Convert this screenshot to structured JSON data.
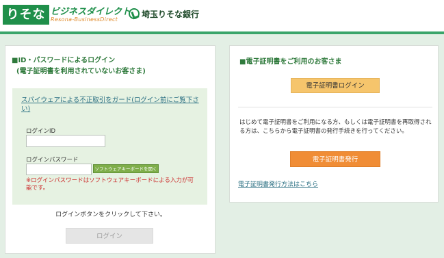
{
  "header": {
    "logo_resona": "りそな",
    "logo_business_direct": "ビジネスダイレクト",
    "logo_business_direct_en": "Resona-BusinessDirect",
    "bank_name": "埼玉りそな銀行"
  },
  "left_panel": {
    "title_line1": "■ID・パスワードによるログイン",
    "title_line2": "(電子証明書を利用されていないお客さま)",
    "spyware_link": "スパイウェアによる不正取引をガード(ログイン前にご覧下さい)",
    "login_id_label": "ログインID",
    "login_id_value": "",
    "login_password_label": "ログインパスワード",
    "login_password_value": "",
    "software_keyboard_button": "ソフトウェアキーボードを開く",
    "warning_text": "※ログインパスワードはソフトウェアキーボードによる入力が可能です。",
    "click_note": "ログインボタンをクリックして下さい。",
    "login_button": "ログイン"
  },
  "right_panel": {
    "title": "■電子証明書をご利用のお客さま",
    "cert_login_button": "電子証明書ログイン",
    "description": "はじめて電子証明書をご利用になる方、もしくは電子証明書を再取得される方は、こちらから電子証明書の発行手続きを行ってください。",
    "cert_issue_button": "電子証明書発行",
    "cert_method_link": "電子証明書発行方法はこちら"
  },
  "colors": {
    "brand_green": "#1f8f4a",
    "header_line": "#3aa56a",
    "page_background": "#e3efe5",
    "cert_login_button": "#f6c56c",
    "cert_issue_button": "#f08d36",
    "warning_red": "#cc2a2a",
    "link": "#2a6f82"
  }
}
